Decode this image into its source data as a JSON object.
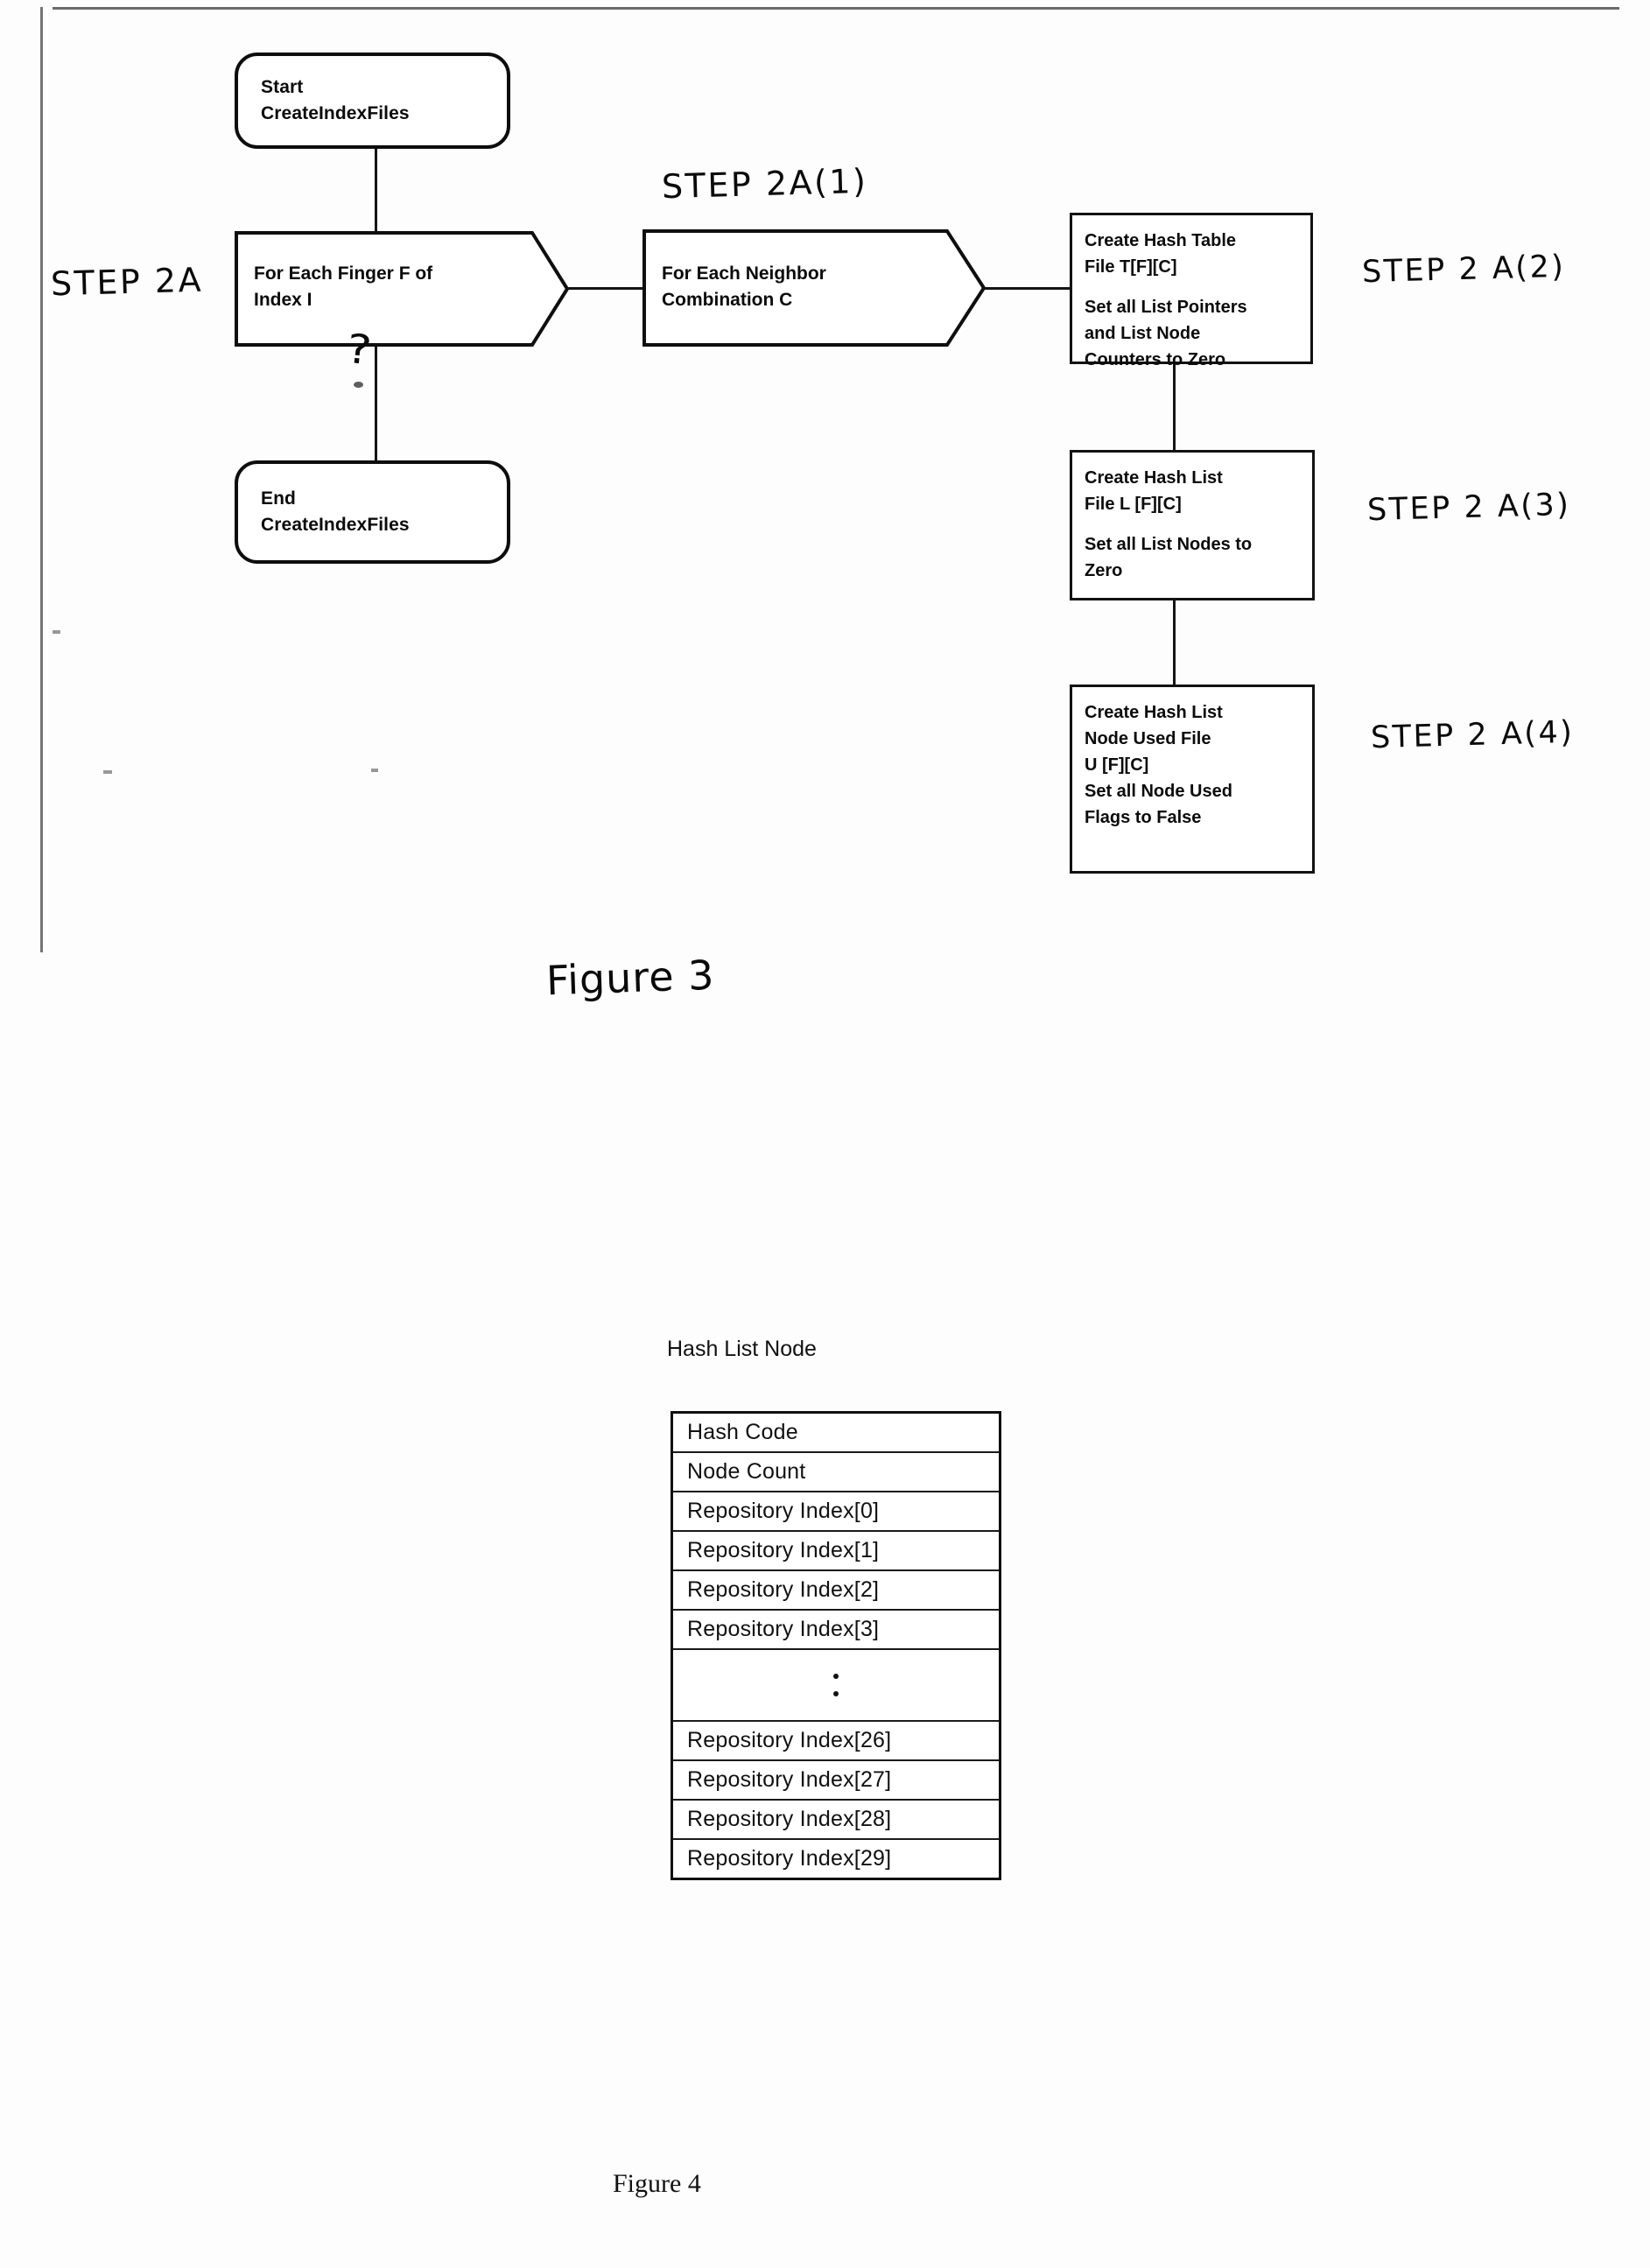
{
  "figure3": {
    "caption": "Figure 3",
    "nodes": {
      "start": {
        "line1": "Start",
        "line2": "CreateIndexFiles"
      },
      "for_each_finger": {
        "line1": "For Each Finger F of",
        "line2": "Index I"
      },
      "end": {
        "line1": "End",
        "line2": "CreateIndexFiles"
      },
      "for_each_neighbor": {
        "line1": "For Each Neighbor",
        "line2": "Combination C"
      },
      "create_hash_table": {
        "line1": "Create Hash Table",
        "line2": "File T[F][C]",
        "line3": "Set all List Pointers",
        "line4": "and List Node",
        "line5": "Counters to Zero"
      },
      "create_hash_list": {
        "line1": "Create Hash List",
        "line2": "File L [F][C]",
        "line3": "Set all List Nodes to",
        "line4": "Zero"
      },
      "create_node_used": {
        "line1": "Create Hash List",
        "line2": "Node Used File",
        "line3": "U [F][C]",
        "line4": "Set all Node Used",
        "line5": "Flags to False"
      }
    },
    "annotations": {
      "step_2a": "STEP 2A",
      "step_2a_1": "STEP 2A(1)",
      "step_2a_2": "STEP 2 A(2)",
      "step_2a_3": "STEP 2 A(3)",
      "step_2a_4": "STEP 2 A(4)",
      "question_mark": "?"
    }
  },
  "figure4": {
    "caption": "Figure 4",
    "table_title": "Hash List Node",
    "rows": [
      "Hash Code",
      "Node Count",
      "Repository Index[0]",
      "Repository Index[1]",
      "Repository Index[2]",
      "Repository Index[3]",
      "ELLIPSIS",
      "Repository Index[26]",
      "Repository Index[27]",
      "Repository Index[28]",
      "Repository Index[29]"
    ]
  },
  "colors": {
    "ink": "#0d0d0d",
    "paper": "#fdfdfd"
  }
}
